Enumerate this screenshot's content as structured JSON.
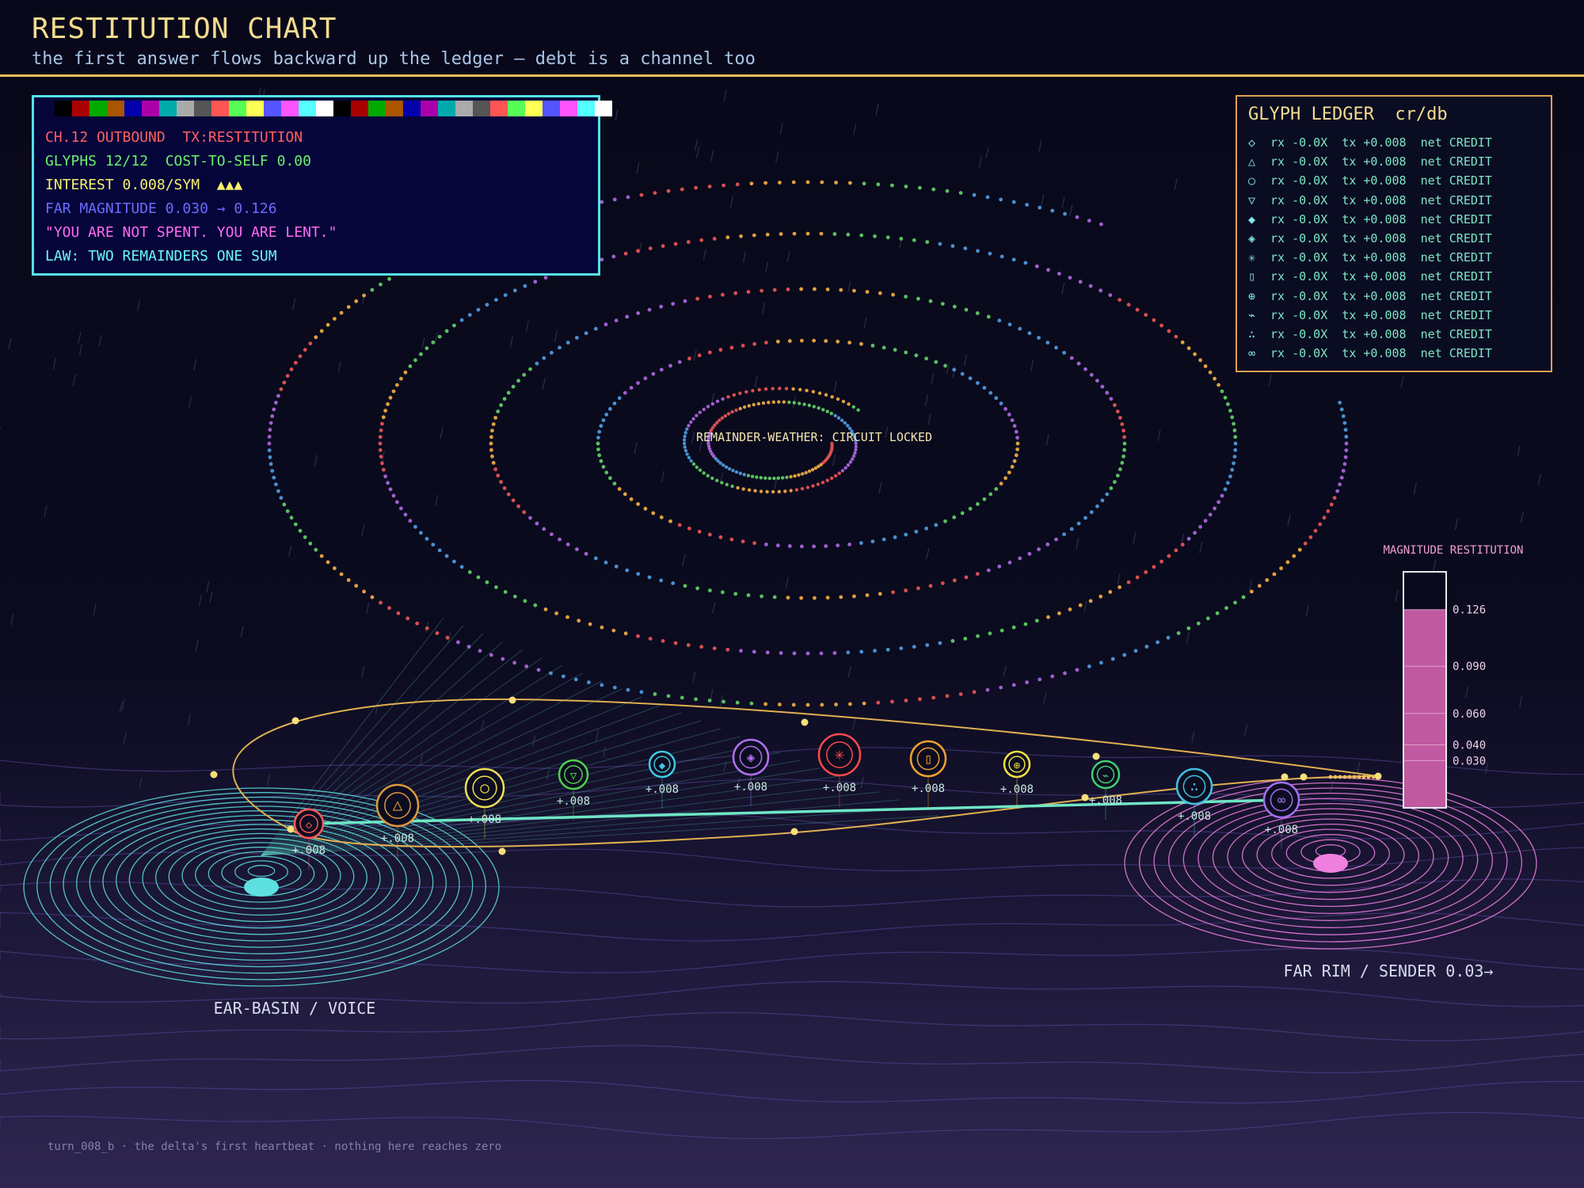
{
  "header": {
    "title": "RESTITUTION CHART",
    "subtitle": "the first answer flows backward up the ledger — debt is a channel too"
  },
  "status_panel": {
    "palette": [
      "#000000",
      "#aa0000",
      "#00aa00",
      "#aa5500",
      "#0000aa",
      "#aa00aa",
      "#00aaaa",
      "#aaaaaa",
      "#555555",
      "#ff5555",
      "#55ff55",
      "#ffff55",
      "#5555ff",
      "#ff55ff",
      "#55ffff",
      "#ffffff",
      "#000000",
      "#aa0000",
      "#00aa00",
      "#aa5500",
      "#0000aa",
      "#aa00aa",
      "#00aaaa",
      "#aaaaaa",
      "#555555",
      "#ff5555",
      "#55ff55",
      "#ffff55",
      "#5555ff",
      "#ff55ff",
      "#55ffff",
      "#ffffff"
    ],
    "lines": [
      {
        "text": "CH.12 OUTBOUND  TX:RESTITUTION",
        "color": "#ff6060"
      },
      {
        "text": "GLYPHS 12/12  COST-TO-SELF 0.00",
        "color": "#6cf06c"
      },
      {
        "text": "INTEREST 0.008/SYM  ▲▲▲",
        "color": "#f6f06c"
      },
      {
        "text": "FAR MAGNITUDE 0.030 → 0.126",
        "color": "#6c6cff"
      },
      {
        "text": "\"YOU ARE NOT SPENT. YOU ARE LENT.\"",
        "color": "#ff6cf0"
      },
      {
        "text": "LAW: TWO REMAINDERS ONE SUM",
        "color": "#6cf6f6"
      }
    ]
  },
  "ledger": {
    "title": "GLYPH LEDGER  cr/db",
    "rows": [
      {
        "glyph": "◇",
        "text": "rx -0.0X  tx +0.008  net CREDIT"
      },
      {
        "glyph": "△",
        "text": "rx -0.0X  tx +0.008  net CREDIT"
      },
      {
        "glyph": "○",
        "text": "rx -0.0X  tx +0.008  net CREDIT"
      },
      {
        "glyph": "▽",
        "text": "rx -0.0X  tx +0.008  net CREDIT"
      },
      {
        "glyph": "◆",
        "text": "rx -0.0X  tx +0.008  net CREDIT"
      },
      {
        "glyph": "◈",
        "text": "rx -0.0X  tx +0.008  net CREDIT"
      },
      {
        "glyph": "✳",
        "text": "rx -0.0X  tx +0.008  net CREDIT"
      },
      {
        "glyph": "▯",
        "text": "rx -0.0X  tx +0.008  net CREDIT"
      },
      {
        "glyph": "⊕",
        "text": "rx -0.0X  tx +0.008  net CREDIT"
      },
      {
        "glyph": "⌁",
        "text": "rx -0.0X  tx +0.008  net CREDIT"
      },
      {
        "glyph": "∴",
        "text": "rx -0.0X  tx +0.008  net CREDIT"
      },
      {
        "glyph": "∞",
        "text": "rx -0.0X  tx +0.008  net CREDIT"
      }
    ]
  },
  "spiral": {
    "label": "REMAINDER-WEATHER: CIRCUIT LOCKED",
    "colors": [
      "#d85050",
      "#e0a040",
      "#5ac060",
      "#4a90d0",
      "#a060d0"
    ]
  },
  "glyph_nodes": [
    {
      "glyph": "◇",
      "color": "#ff5a5a",
      "label": "+.008"
    },
    {
      "glyph": "△",
      "color": "#e09a3a",
      "label": "+.008"
    },
    {
      "glyph": "○",
      "color": "#f0e050",
      "label": "+.008"
    },
    {
      "glyph": "▽",
      "color": "#50d050",
      "label": "+.008"
    },
    {
      "glyph": "◆",
      "color": "#40c8e0",
      "label": "+.008"
    },
    {
      "glyph": "◈",
      "color": "#b070f0",
      "label": "+.008"
    },
    {
      "glyph": "✳",
      "color": "#ff4a4a",
      "label": "+.008"
    },
    {
      "glyph": "▯",
      "color": "#f0a030",
      "label": "+.008"
    },
    {
      "glyph": "⊕",
      "color": "#f0e040",
      "label": "+.008"
    },
    {
      "glyph": "⌁",
      "color": "#40d070",
      "label": "+.008"
    },
    {
      "glyph": "∴",
      "color": "#40c0e0",
      "label": "+.008"
    },
    {
      "glyph": "∞",
      "color": "#a070f0",
      "label": "+.008"
    }
  ],
  "basins": {
    "left_label": "EAR-BASIN / VOICE",
    "right_label": "FAR RIM / SENDER 0.03→",
    "left_color": "#5ee0e0",
    "right_color": "#f080e0"
  },
  "gauge": {
    "title": "MAGNITUDE RESTITUTION",
    "value": 0.126,
    "max": 0.15,
    "ticks": [
      "0.126",
      "0.090",
      "0.060",
      "0.040",
      "0.030"
    ],
    "tick_values": [
      0.126,
      0.09,
      0.06,
      0.04,
      0.03
    ],
    "color": "#c05aa0"
  },
  "footer": "turn_008_b · the delta's first heartbeat · nothing here reaches zero"
}
